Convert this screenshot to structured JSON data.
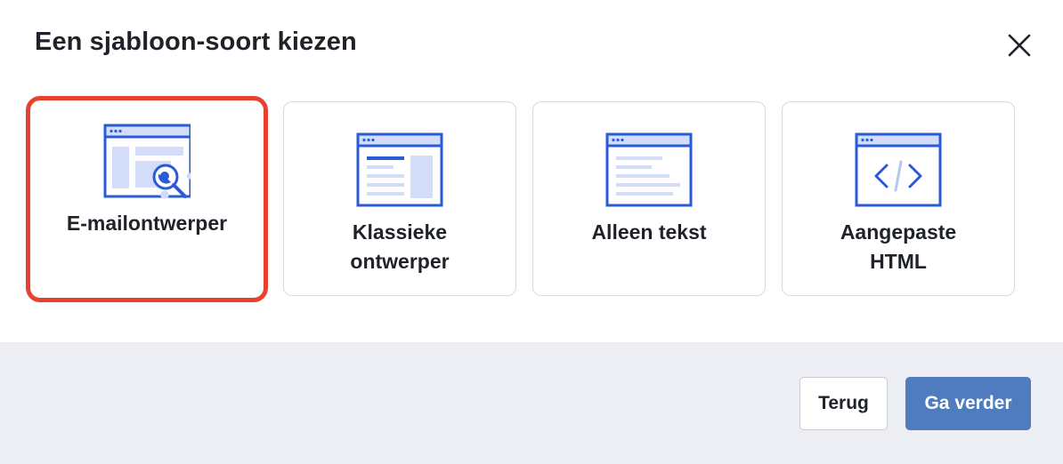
{
  "dialog": {
    "title": "Een sjabloon-soort kiezen"
  },
  "templates": [
    {
      "label": "E-mailontwerper",
      "icon": "email-designer-icon",
      "selected": true
    },
    {
      "label": "Klassieke ontwerper",
      "icon": "classic-designer-icon",
      "selected": false
    },
    {
      "label": "Alleen tekst",
      "icon": "text-only-icon",
      "selected": false
    },
    {
      "label": "Aangepaste HTML",
      "icon": "custom-html-icon",
      "selected": false
    }
  ],
  "footer": {
    "back_label": "Terug",
    "next_label": "Ga verder"
  },
  "colors": {
    "accent_blue": "#2a5bd7",
    "light_blue": "#d3ddf7",
    "selection_red": "#e5432f",
    "primary_button": "#4f7bbf",
    "footer_bg": "#eceef3"
  }
}
